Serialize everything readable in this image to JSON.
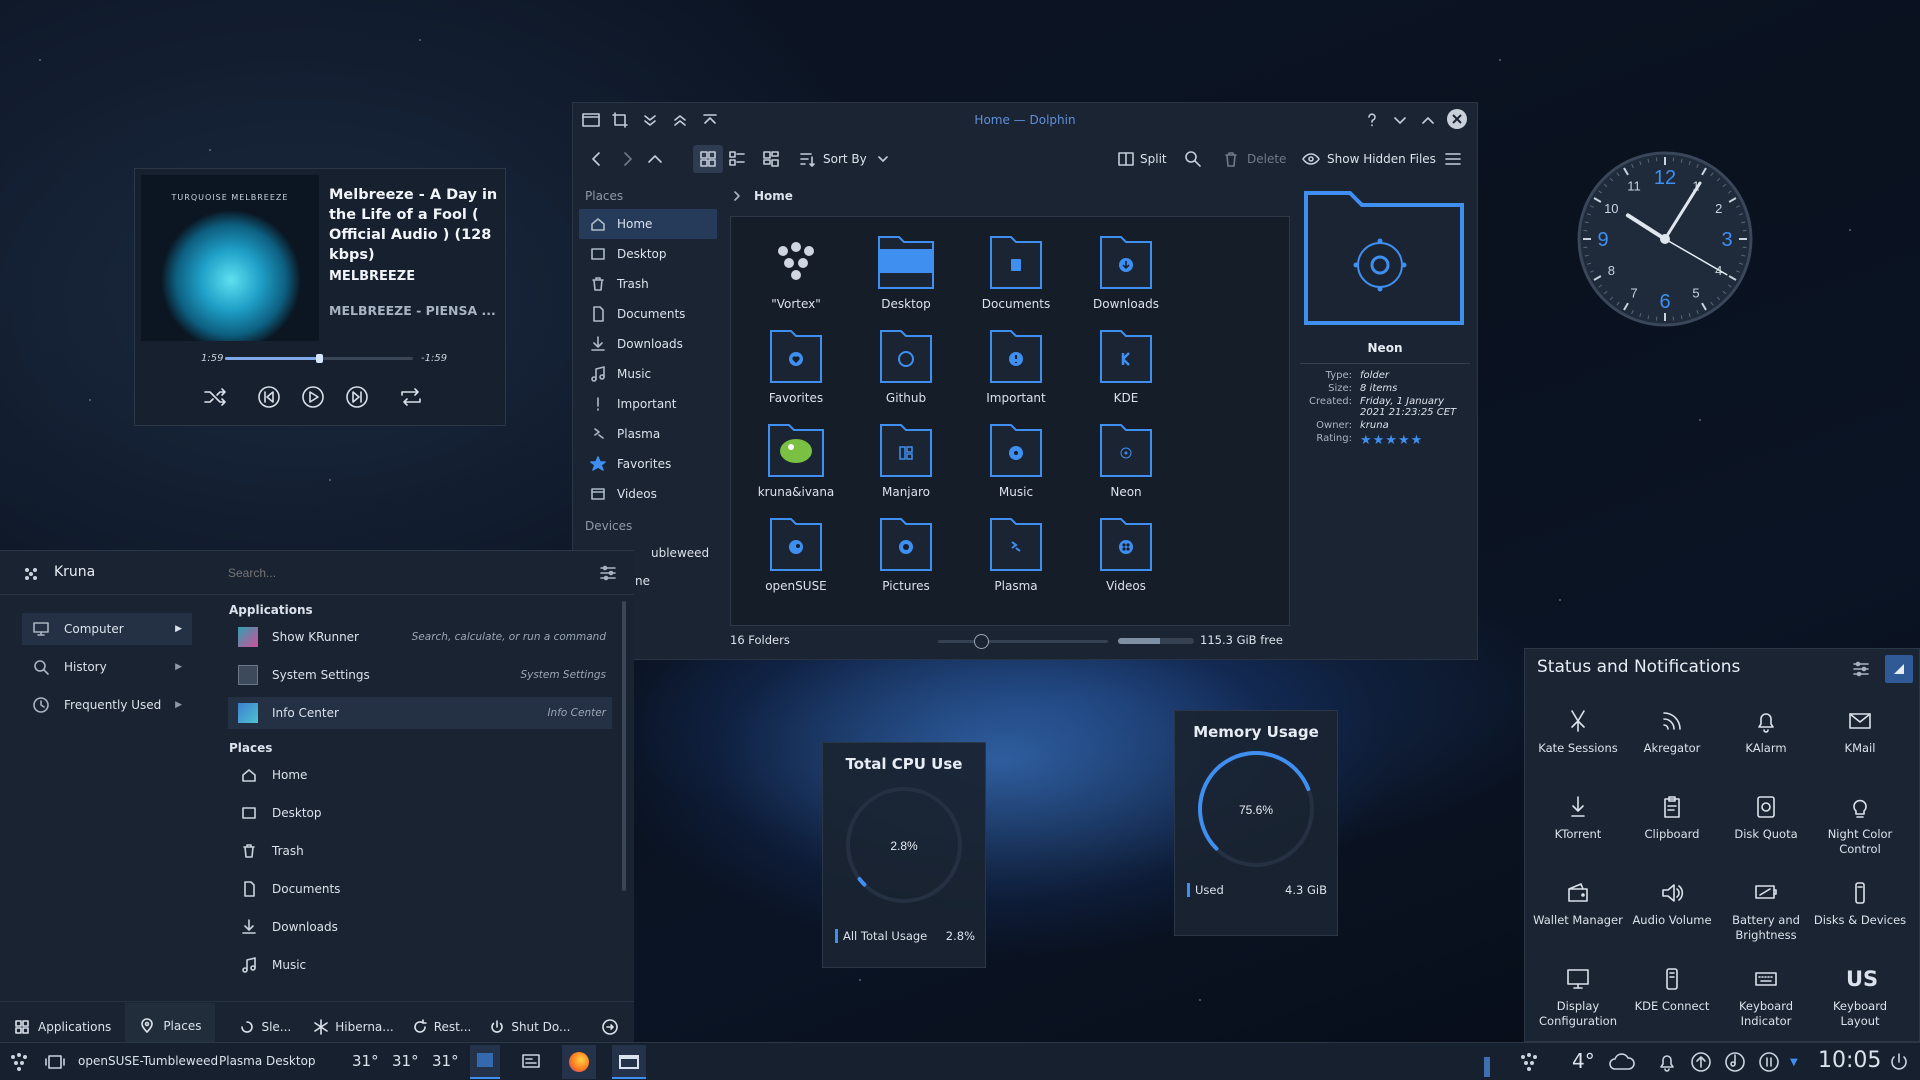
{
  "player": {
    "album_cover_text": "TURQUOISE MELBREEZE",
    "title": "Melbreeze - A Day in the Life of a Fool ( Official Audio ) (128 kbps)",
    "artist": "MELBREEZE",
    "album": "MELBREEZE - PIENSA ...",
    "elapsed": "1:59",
    "remaining": "-1:59",
    "progress": 0.5
  },
  "dolphin": {
    "window_title": "Home — Dolphin",
    "sort_by": "Sort By",
    "split": "Split",
    "delete": "Delete",
    "show_hidden": "Show Hidden Files",
    "breadcrumb": "Home",
    "places_header": "Places",
    "places": [
      "Home",
      "Desktop",
      "Trash",
      "Documents",
      "Downloads",
      "Music",
      "Important",
      "Plasma",
      "Favorites",
      "Videos"
    ],
    "devices_header": "Devices",
    "devices": [
      "ubleweed",
      "ne"
    ],
    "files": [
      {
        "name": "\"Vortex\"",
        "icon": "opensuse-logo-icon"
      },
      {
        "name": "Desktop",
        "icon": "desktop-folder-icon"
      },
      {
        "name": "Documents",
        "icon": "documents-folder-icon"
      },
      {
        "name": "Downloads",
        "icon": "downloads-folder-icon"
      },
      {
        "name": "Favorites",
        "icon": "favorites-folder-icon"
      },
      {
        "name": "Github",
        "icon": "github-folder-icon"
      },
      {
        "name": "Important",
        "icon": "important-folder-icon"
      },
      {
        "name": "KDE",
        "icon": "kde-folder-icon"
      },
      {
        "name": "kruna&ivana",
        "icon": "image-file-icon"
      },
      {
        "name": "Manjaro",
        "icon": "manjaro-folder-icon"
      },
      {
        "name": "Music",
        "icon": "music-folder-icon"
      },
      {
        "name": "Neon",
        "icon": "neon-folder-icon"
      },
      {
        "name": "openSUSE",
        "icon": "opensuse-folder-icon"
      },
      {
        "name": "Pictures",
        "icon": "pictures-folder-icon"
      },
      {
        "name": "Plasma",
        "icon": "plasma-folder-icon"
      },
      {
        "name": "Videos",
        "icon": "videos-folder-icon"
      }
    ],
    "status_count": "16 Folders",
    "free_space": "115.3 GiB free",
    "zoom_fraction": 0.25,
    "disk_used_fraction": 0.55,
    "info": {
      "name": "Neon",
      "type_k": "Type:",
      "type_v": "folder",
      "size_k": "Size:",
      "size_v": "8 items",
      "created_k": "Created:",
      "created_v": "Friday, 1 January 2021 21:23:25 CET",
      "owner_k": "Owner:",
      "owner_v": "kruna",
      "rating_k": "Rating:",
      "rating_stars": 5
    }
  },
  "launcher": {
    "user": "Kruna",
    "search_placeholder": "Search...",
    "categories": [
      "Computer",
      "History",
      "Frequently Used"
    ],
    "apps_header": "Applications",
    "apps": [
      {
        "name": "Show KRunner",
        "desc": "Search, calculate, or run a command"
      },
      {
        "name": "System Settings",
        "desc": "System Settings"
      },
      {
        "name": "Info Center",
        "desc": "Info Center"
      }
    ],
    "places_header": "Places",
    "places": [
      "Home",
      "Desktop",
      "Trash",
      "Documents",
      "Downloads",
      "Music"
    ],
    "footer": {
      "applications": "Applications",
      "places": "Places",
      "sleep": "Sle...",
      "hibernate": "Hiberna...",
      "restart": "Rest...",
      "shutdown": "Shut Do..."
    }
  },
  "cpu_widget": {
    "title": "Total CPU Use",
    "value": "2.8%",
    "legend": "All Total Usage",
    "legend_value": "2.8%",
    "fraction": 0.028
  },
  "memory_widget": {
    "title": "Memory Usage",
    "value": "75.6%",
    "legend": "Used",
    "legend_value": "4.3 GiB",
    "fraction": 0.756
  },
  "clock_widget": {
    "hours": 10,
    "minutes": 5,
    "seconds": 20
  },
  "status": {
    "title": "Status and Notifications",
    "items": [
      {
        "label": "Kate Sessions",
        "icon": "kate-icon"
      },
      {
        "label": "Akregator",
        "icon": "rss-icon"
      },
      {
        "label": "KAlarm",
        "icon": "bell-icon"
      },
      {
        "label": "KMail",
        "icon": "mail-icon"
      },
      {
        "label": "KTorrent",
        "icon": "download-arrow-icon"
      },
      {
        "label": "Clipboard",
        "icon": "clipboard-icon"
      },
      {
        "label": "Disk Quota",
        "icon": "disk-icon"
      },
      {
        "label": "Night Color Control",
        "icon": "bulb-icon"
      },
      {
        "label": "Wallet Manager",
        "icon": "wallet-icon"
      },
      {
        "label": "Audio Volume",
        "icon": "speaker-icon"
      },
      {
        "label": "Battery and Brightness",
        "icon": "battery-icon"
      },
      {
        "label": "Disks & Devices",
        "icon": "usb-icon"
      },
      {
        "label": "Display Configuration",
        "icon": "monitor-icon"
      },
      {
        "label": "KDE Connect",
        "icon": "phone-icon"
      },
      {
        "label": "Keyboard Indicator",
        "icon": "keyboard-icon"
      },
      {
        "label": "US",
        "sub": "Keyboard Layout",
        "icon": "layout-text"
      }
    ]
  },
  "taskbar": {
    "activity": "openSUSE-Tumbleweed",
    "plasma": "Plasma Desktop",
    "temps": [
      "31°",
      "31°",
      "31°"
    ],
    "weather": "4°",
    "time": "10:05"
  }
}
